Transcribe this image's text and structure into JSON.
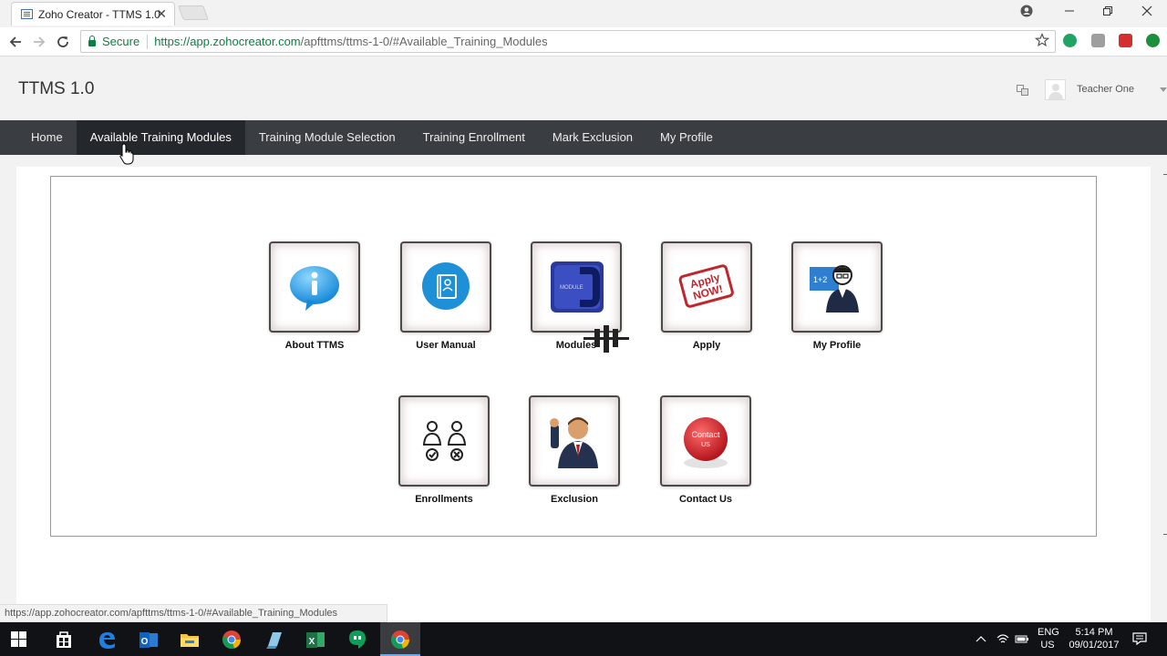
{
  "browser": {
    "tab_title": "Zoho Creator - TTMS 1.0",
    "tab_close": "✕",
    "secure_label": "Secure",
    "url_host": "https://app.zohocreator.com",
    "url_path": "/apfttms/ttms-1-0/#Available_Training_Modules",
    "status_url": "https://app.zohocreator.com/apfttms/ttms-1-0/#Available_Training_Modules"
  },
  "app": {
    "title": "TTMS 1.0",
    "user_name": "Teacher One"
  },
  "menu": {
    "items": [
      {
        "label": "Home"
      },
      {
        "label": "Available Training Modules"
      },
      {
        "label": "Training Module Selection"
      },
      {
        "label": "Training Enrollment"
      },
      {
        "label": "Mark Exclusion"
      },
      {
        "label": "My Profile"
      }
    ],
    "active_index": 1
  },
  "tiles": [
    {
      "label": "About TTMS",
      "icon": "info-bubble-icon"
    },
    {
      "label": "User Manual",
      "icon": "manual-book-icon"
    },
    {
      "label": "Modules",
      "icon": "module-icon",
      "icon_text": "MODULE"
    },
    {
      "label": "Apply",
      "icon": "apply-now-stamp-icon",
      "icon_text": "Apply NOW!"
    },
    {
      "label": "My Profile",
      "icon": "teacher-profile-icon",
      "icon_text": "1+2"
    },
    {
      "label": "Enrollments",
      "icon": "enrollment-approve-reject-icon"
    },
    {
      "label": "Exclusion",
      "icon": "raised-hand-person-icon"
    },
    {
      "label": "Contact Us",
      "icon": "contact-us-button-icon",
      "icon_text": "Contact US"
    }
  ],
  "taskbar": {
    "language": "ENG",
    "region": "US",
    "time": "5:14 PM",
    "date": "09/01/2017"
  },
  "colors": {
    "menu_bg": "#3a3d42",
    "menu_active_bg": "#24272b",
    "secure_green": "#0b8043",
    "taskbar_bg": "#101215"
  }
}
